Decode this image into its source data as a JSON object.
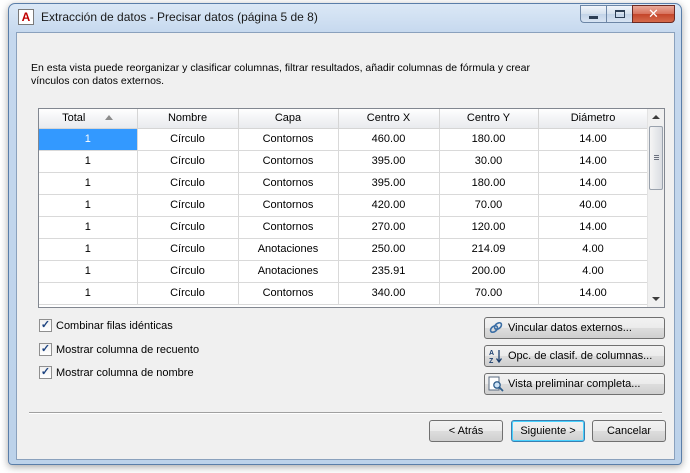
{
  "window": {
    "title": "Extracción de datos - Precisar datos (página 5 de 8)"
  },
  "description": "En esta vista puede reorganizar y clasificar columnas, filtrar resultados, añadir columnas de fórmula y crear vínculos con datos externos.",
  "table": {
    "columns": [
      "Total",
      "Nombre",
      "Capa",
      "Centro X",
      "Centro Y",
      "Diámetro"
    ],
    "rows": [
      [
        "1",
        "Círculo",
        "Contornos",
        "460.00",
        "180.00",
        "14.00"
      ],
      [
        "1",
        "Círculo",
        "Contornos",
        "395.00",
        "30.00",
        "14.00"
      ],
      [
        "1",
        "Círculo",
        "Contornos",
        "395.00",
        "180.00",
        "14.00"
      ],
      [
        "1",
        "Círculo",
        "Contornos",
        "420.00",
        "70.00",
        "40.00"
      ],
      [
        "1",
        "Círculo",
        "Contornos",
        "270.00",
        "120.00",
        "14.00"
      ],
      [
        "1",
        "Círculo",
        "Anotaciones",
        "250.00",
        "214.09",
        "4.00"
      ],
      [
        "1",
        "Círculo",
        "Anotaciones",
        "235.91",
        "200.00",
        "4.00"
      ],
      [
        "1",
        "Círculo",
        "Contornos",
        "340.00",
        "70.00",
        "14.00"
      ]
    ]
  },
  "options": {
    "combine_rows": {
      "label": "Combinar filas idénticas",
      "checked": true
    },
    "show_count": {
      "label": "Mostrar columna de recuento",
      "checked": true
    },
    "show_name": {
      "label": "Mostrar columna de nombre",
      "checked": true
    }
  },
  "side_buttons": {
    "link_external": "Vincular datos externos...",
    "sort_options": "Opc. de clasif. de columnas...",
    "full_preview": "Vista preliminar completa..."
  },
  "footer": {
    "back": "< Atrás",
    "next": "Siguiente >",
    "cancel": "Cancelar"
  },
  "icons": {
    "app": "autocad-a-icon",
    "link": "chain-link-icon",
    "sort": "az-sort-icon",
    "preview": "magnifier-icon"
  },
  "colors": {
    "selection": "#3399ff",
    "close_button": "#c4452b"
  }
}
